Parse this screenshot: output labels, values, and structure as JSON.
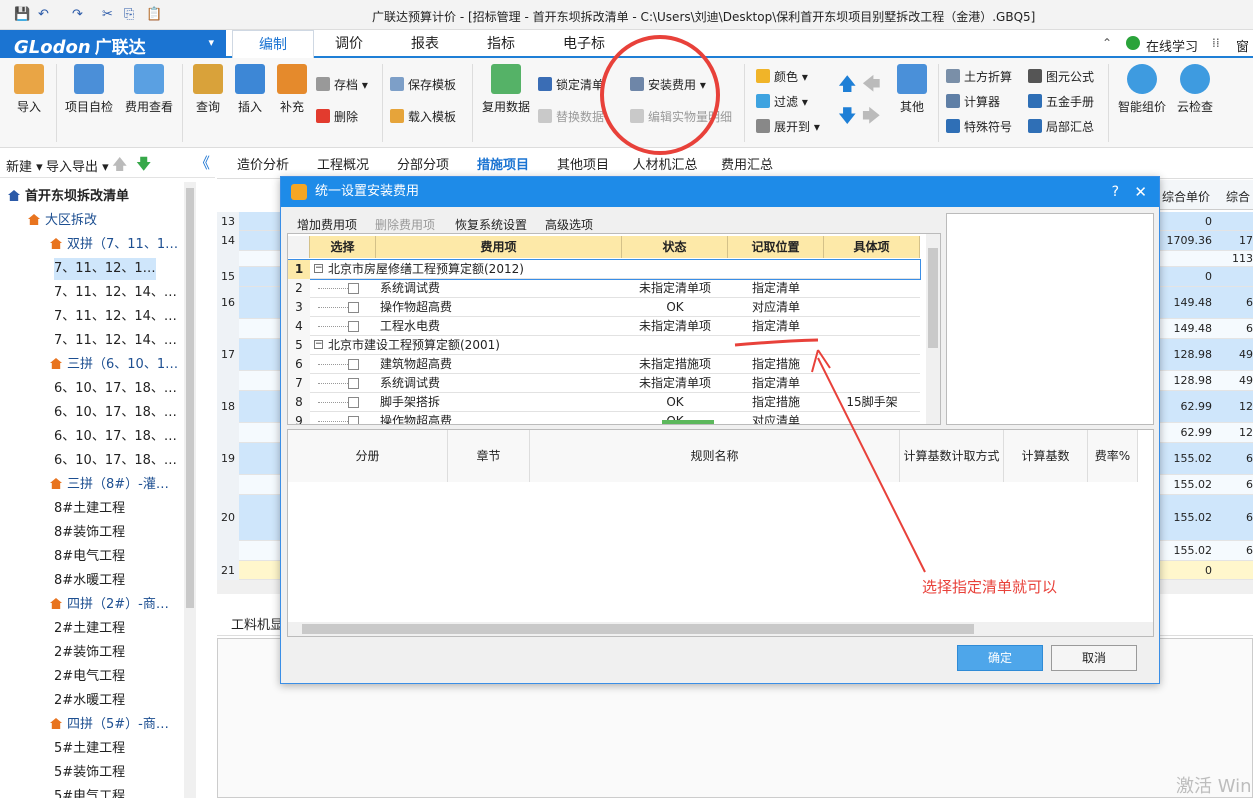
{
  "window": {
    "title": "广联达预算计价 - [招标管理 - 首开东坝拆改清单 - C:\\Users\\刘迪\\Desktop\\保利首开东坝项目别墅拆改工程（金港）.GBQ5]"
  },
  "quick_access": {
    "save": "💾",
    "undo": "↶",
    "redo": "↷",
    "cut": "✂",
    "copy": "⎘",
    "paste": "📋"
  },
  "brand": {
    "logo_text": "GLodon",
    "logo_cn": "广联达",
    "logo_dd": "▾"
  },
  "menu_tabs": [
    "编制",
    "调价",
    "报表",
    "指标",
    "电子标"
  ],
  "menu_active": "编制",
  "top_right": {
    "online_learning": "在线学习",
    "more": "窗"
  },
  "ribbon": {
    "import": "导入",
    "self_check": "项目自检",
    "fee_view": "费用查看",
    "query": "查询",
    "insert": "插入",
    "supplement": "补充",
    "archive": "存档",
    "delete": "删除",
    "save_template": "保存模板",
    "load_template": "载入模板",
    "reuse_data": "复用数据",
    "lock_list": "锁定清单",
    "replace_data": "替换数据",
    "install_fee": "安装费用",
    "edit_detail": "编辑实物量明细",
    "color": "颜色",
    "filter": "过滤",
    "expand_to": "展开到",
    "other": "其他",
    "earth_calc": "土方折算",
    "calculator": "计算器",
    "special_symbol": "特殊符号",
    "figure_formula": "图元公式",
    "hardware_manual": "五金手册",
    "local_summary": "局部汇总",
    "smart_price": "智能组价",
    "cloud_check": "云检查"
  },
  "left_panel": {
    "new": "新建",
    "import_export": "导入导出",
    "collapse": "《"
  },
  "tree": [
    {
      "label": "首开东坝拆改清单",
      "level": 0
    },
    {
      "label": "大区拆改",
      "level": 1
    },
    {
      "label": "双拼（7、11、1…",
      "level": 2
    },
    {
      "label": "7、11、12、1…",
      "level": 3,
      "selected": true
    },
    {
      "label": "7、11、12、14、…",
      "level": 3
    },
    {
      "label": "7、11、12、14、…",
      "level": 3
    },
    {
      "label": "7、11、12、14、…",
      "level": 3
    },
    {
      "label": "三拼（6、10、1…",
      "level": 2
    },
    {
      "label": "6、10、17、18、…",
      "level": 3
    },
    {
      "label": "6、10、17、18、…",
      "level": 3
    },
    {
      "label": "6、10、17、18、…",
      "level": 3
    },
    {
      "label": "6、10、17、18、…",
      "level": 3
    },
    {
      "label": "三拼（8#）-灌…",
      "level": 2
    },
    {
      "label": "8#土建工程",
      "level": 3
    },
    {
      "label": "8#装饰工程",
      "level": 3
    },
    {
      "label": "8#电气工程",
      "level": 3
    },
    {
      "label": "8#水暖工程",
      "level": 3
    },
    {
      "label": "四拼（2#）-商…",
      "level": 2
    },
    {
      "label": "2#土建工程",
      "level": 3
    },
    {
      "label": "2#装饰工程",
      "level": 3
    },
    {
      "label": "2#电气工程",
      "level": 3
    },
    {
      "label": "2#水暖工程",
      "level": 3
    },
    {
      "label": "四拼（5#）-商…",
      "level": 2
    },
    {
      "label": "5#土建工程",
      "level": 3
    },
    {
      "label": "5#装饰工程",
      "level": 3
    },
    {
      "label": "5#电气工程",
      "level": 3
    }
  ],
  "sub_tabs": [
    "造价分析",
    "工程概况",
    "分部分项",
    "措施项目",
    "其他项目",
    "人材机汇总",
    "费用汇总"
  ],
  "sub_tab_active": "措施项目",
  "bg_grid": {
    "right_headers": [
      "综合单价",
      "综合"
    ],
    "rows": [
      {
        "n": "13",
        "v1": "0",
        "v2": ""
      },
      {
        "n": "14",
        "v1": "1709.36",
        "v2": "17"
      },
      {
        "n": "",
        "v1": "",
        "v2": "113"
      },
      {
        "n": "15",
        "v1": "0",
        "v2": ""
      },
      {
        "n": "16",
        "v1": "149.48",
        "v2": "6"
      },
      {
        "n": "",
        "v1": "149.48",
        "v2": "6"
      },
      {
        "n": "17",
        "v1": "128.98",
        "v2": "49"
      },
      {
        "n": "",
        "v1": "128.98",
        "v2": "49"
      },
      {
        "n": "18",
        "v1": "62.99",
        "v2": "12"
      },
      {
        "n": "",
        "v1": "62.99",
        "v2": "12"
      },
      {
        "n": "19",
        "v1": "155.02",
        "v2": "6"
      },
      {
        "n": "",
        "v1": "155.02",
        "v2": "6"
      },
      {
        "n": "20",
        "v1": "155.02",
        "v2": "6"
      },
      {
        "n": "",
        "v1": "155.02",
        "v2": "6"
      },
      {
        "n": "21",
        "v1": "0",
        "v2": ""
      }
    ],
    "bottom_tab": "工料机显"
  },
  "dialog": {
    "title": "统一设置安装费用",
    "help": "?",
    "close": "✕",
    "menu": [
      "增加费用项",
      "删除费用项",
      "恢复系统设置",
      "高级选项"
    ],
    "headers": [
      "选择",
      "费用项",
      "状态",
      "记取位置",
      "具体项"
    ],
    "rows": [
      {
        "n": "1",
        "group": true,
        "name": "北京市房屋修缮工程预算定额(2012)"
      },
      {
        "n": "2",
        "name": "系统调试费",
        "status": "未指定清单项",
        "position": "指定清单",
        "item": ""
      },
      {
        "n": "3",
        "name": "操作物超高费",
        "status": "OK",
        "position": "对应清单",
        "item": ""
      },
      {
        "n": "4",
        "name": "工程水电费",
        "status": "未指定清单项",
        "position": "指定清单",
        "item": ""
      },
      {
        "n": "5",
        "group": true,
        "name": "北京市建设工程预算定额(2001)"
      },
      {
        "n": "6",
        "name": "建筑物超高费",
        "status": "未指定措施项",
        "position": "指定措施",
        "item": ""
      },
      {
        "n": "7",
        "name": "系统调试费",
        "status": "未指定清单项",
        "position": "指定清单",
        "item": ""
      },
      {
        "n": "8",
        "name": "脚手架搭拆",
        "status": "OK",
        "position": "指定措施",
        "item": "15脚手架"
      },
      {
        "n": "9",
        "name": "操作物超高费",
        "status": "OK",
        "position": "对应清单",
        "item": ""
      }
    ],
    "lower_headers": [
      "分册",
      "章节",
      "规则名称",
      "计算基数计取方式",
      "计算基数",
      "费率%"
    ],
    "ok": "确定",
    "cancel": "取消"
  },
  "annotation": {
    "text": "选择指定清单就可以",
    "color": "#e8413a"
  },
  "watermark": "激活 Win"
}
